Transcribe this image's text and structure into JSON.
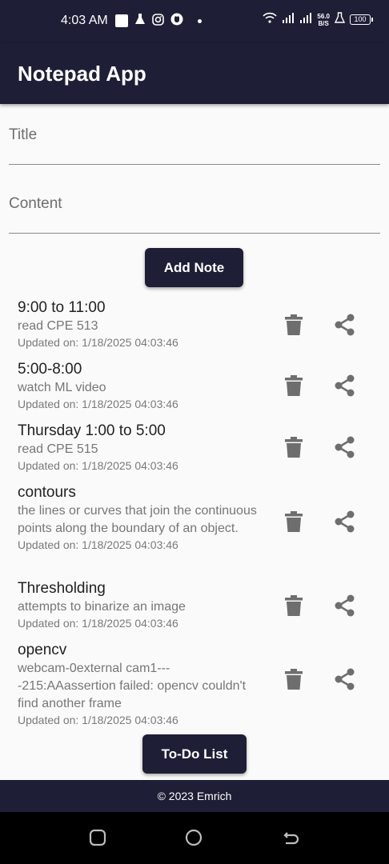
{
  "status_bar": {
    "time": "4:03 AM",
    "net_speed_value": "56.0",
    "net_speed_unit": "B/S",
    "battery": "100"
  },
  "app_bar": {
    "title": "Notepad App"
  },
  "form": {
    "title_placeholder": "Title",
    "title_value": "",
    "content_placeholder": "Content",
    "content_value": "",
    "add_button": "Add Note"
  },
  "notes": [
    {
      "title": "9:00 to 11:00",
      "content": "read CPE 513",
      "updated": "Updated on: 1/18/2025 04:03:46"
    },
    {
      "title": "5:00-8:00",
      "content": "watch ML video",
      "updated": "Updated on: 1/18/2025 04:03:46"
    },
    {
      "title": "Thursday 1:00 to 5:00",
      "content": "read CPE 515",
      "updated": "Updated on: 1/18/2025 04:03:46"
    },
    {
      "title": "contours",
      "content": "the lines or curves that join the continuous points along the boundary of an object.",
      "updated": "Updated on: 1/18/2025 04:03:46"
    },
    {
      "title": "Thresholding",
      "content": "attempts to binarize an image",
      "updated": "Updated on: 1/18/2025 04:03:46"
    },
    {
      "title": "opencv",
      "content": "webcam-0external cam1----215:AAassertion failed: opencv couldn't find another frame",
      "updated": "Updated on: 1/18/2025 04:03:46"
    }
  ],
  "todo_button": "To-Do List",
  "footer": {
    "text": "© 2023 Emrich"
  },
  "icons": {
    "delete": "trash-icon",
    "share": "share-icon",
    "nav_recents": "recents-icon",
    "nav_home": "home-icon",
    "nav_back": "back-icon"
  },
  "colors": {
    "primary": "#1e1e36",
    "background": "#fafafa",
    "icon_gray": "#6e6e6e"
  }
}
